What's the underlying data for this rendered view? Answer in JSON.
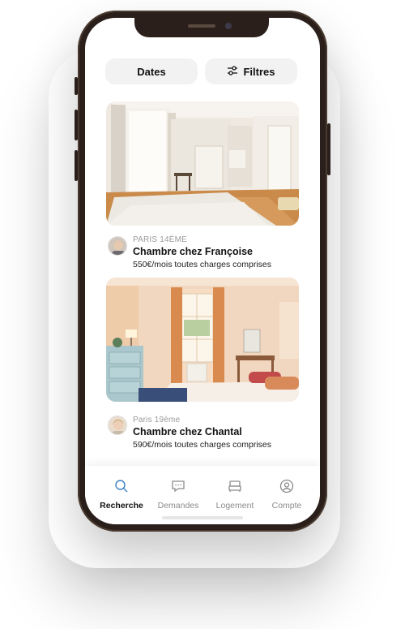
{
  "filters": {
    "dates_label": "Dates",
    "filtres_label": "Filtres"
  },
  "listings": [
    {
      "location": "PARIS 14ÈME",
      "title": "Chambre chez Françoise",
      "price": "550€/mois toutes charges comprises"
    },
    {
      "location": "Paris 19ème",
      "title": "Chambre chez Chantal",
      "price": "590€/mois toutes charges comprises"
    }
  ],
  "tabbar": {
    "items": [
      {
        "label": "Recherche",
        "icon": "search-icon",
        "active": true
      },
      {
        "label": "Demandes",
        "icon": "chat-icon",
        "active": false
      },
      {
        "label": "Logement",
        "icon": "bed-icon",
        "active": false
      },
      {
        "label": "Compte",
        "icon": "user-icon",
        "active": false
      }
    ]
  },
  "colors": {
    "accent": "#3b82c4",
    "phone_frame": "#2a1f1a",
    "pill_bg": "#f2f2f2"
  }
}
